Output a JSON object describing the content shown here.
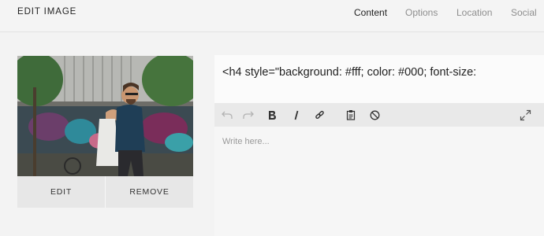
{
  "header": {
    "title": "EDIT IMAGE",
    "tabs": [
      {
        "label": "Content",
        "active": true
      },
      {
        "label": "Options",
        "active": false
      },
      {
        "label": "Location",
        "active": false
      },
      {
        "label": "Social",
        "active": false
      }
    ]
  },
  "image": {
    "subject": "man with glasses and beard walking past graffiti wall",
    "actions": {
      "edit_label": "EDIT",
      "remove_label": "REMOVE"
    }
  },
  "caption": {
    "title_value": "<h4 style=\"background: #fff; color: #000; font-size:"
  },
  "editor": {
    "toolbar": [
      {
        "icon": "undo-icon",
        "enabled": false
      },
      {
        "icon": "redo-icon",
        "enabled": false
      },
      {
        "icon": "bold-icon",
        "enabled": true
      },
      {
        "icon": "italic-icon",
        "enabled": true
      },
      {
        "icon": "link-icon",
        "enabled": true
      },
      {
        "icon": "paste-icon",
        "enabled": true
      },
      {
        "icon": "clear-format-icon",
        "enabled": true
      },
      {
        "icon": "fullscreen-icon",
        "enabled": true
      }
    ],
    "placeholder": "Write here..."
  },
  "colors": {
    "background": "#f3f3f3",
    "toolbar": "#e9e9e9",
    "button": "#e7e7e7",
    "text": "#222222",
    "muted": "#8e8e8e"
  }
}
